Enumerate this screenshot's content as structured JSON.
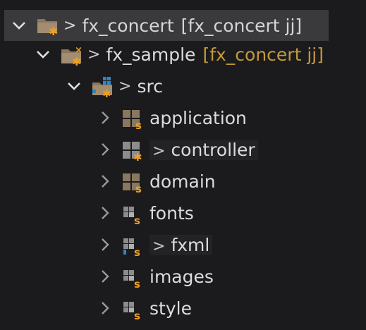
{
  "tree": {
    "project": {
      "dirty_marker": ">",
      "name": "fx_concert",
      "repo": "[fx_concert jj]",
      "icon": "project-folder-icon",
      "expanded": true
    },
    "module": {
      "dirty_marker": ">",
      "name": "fx_sample",
      "repo": "[fx_concert jj]",
      "icon": "project-folder-icon",
      "expanded": true
    },
    "source_folder": {
      "dirty_marker": ">",
      "name": "src",
      "icon": "source-folder-icon",
      "expanded": true
    },
    "packages": [
      {
        "label": "application",
        "dirty_marker": "",
        "icon": "package-icon"
      },
      {
        "label": "controller",
        "dirty_marker": ">",
        "icon": "package-icon"
      },
      {
        "label": "domain",
        "dirty_marker": "",
        "icon": "package-icon"
      },
      {
        "label": "fonts",
        "dirty_marker": "",
        "icon": "empty-package-icon"
      },
      {
        "label": "fxml",
        "dirty_marker": ">",
        "icon": "empty-package-icon"
      },
      {
        "label": "images",
        "dirty_marker": "",
        "icon": "empty-package-icon"
      },
      {
        "label": "style",
        "dirty_marker": "",
        "icon": "empty-package-icon"
      }
    ]
  },
  "colors": {
    "background": "#1b1b1d",
    "selection": "#3a3a3c",
    "text": "#dcdcdc",
    "repo_decoration": "#c29a3c",
    "decorator_orange": "#f0a020",
    "package_brown": "#8a7760",
    "package_gray": "#8c8c8c"
  }
}
